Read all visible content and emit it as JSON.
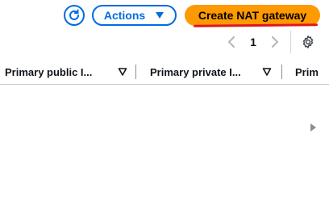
{
  "toolbar": {
    "refresh_icon": "refresh-icon",
    "actions_label": "Actions",
    "create_label": "Create NAT gateway",
    "colors": {
      "primary": "#006ce0",
      "accent": "#ff9900",
      "highlight": "#e0161b"
    }
  },
  "pagination": {
    "current_page": "1",
    "prev_icon": "chevron-left-icon",
    "next_icon": "chevron-right-icon",
    "settings_icon": "gear-icon"
  },
  "table": {
    "columns": [
      {
        "label": "Primary public I..."
      },
      {
        "label": "Primary private I..."
      },
      {
        "label": "Prim"
      }
    ],
    "rows": []
  }
}
